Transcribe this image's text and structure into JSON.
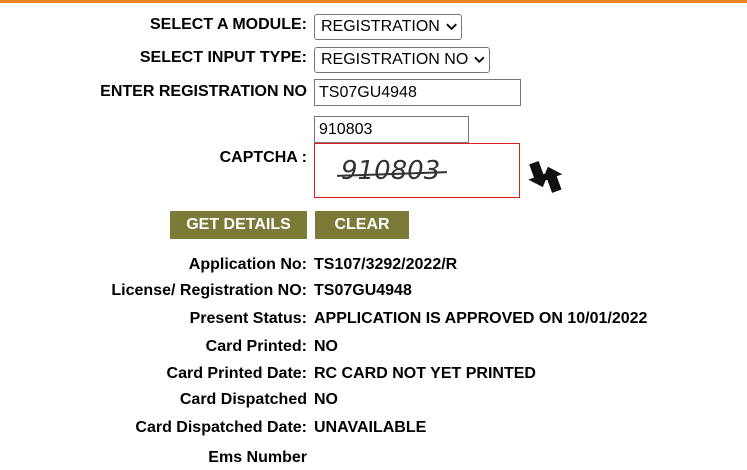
{
  "form": {
    "module_label": "SELECT A MODULE:",
    "module_value": "REGISTRATION",
    "input_type_label": "SELECT INPUT TYPE:",
    "input_type_value": "REGISTRATION NO",
    "reg_no_label": "ENTER REGISTRATION NO",
    "reg_no_value": "TS07GU4948",
    "captcha_input_value": "910803",
    "captcha_label": "CAPTCHA :",
    "captcha_image_text": "910803",
    "get_details_label": "GET DETAILS",
    "clear_label": "CLEAR"
  },
  "results": [
    {
      "label": "Application No:",
      "value": "TS107/3292/2022/R"
    },
    {
      "label": "License/ Registration NO:",
      "value": "TS07GU4948"
    },
    {
      "label": "Present Status:",
      "value": "APPLICATION IS APPROVED ON 10/01/2022"
    },
    {
      "label": "Card Printed:",
      "value": "NO"
    },
    {
      "label": "Card Printed Date:",
      "value": "RC CARD NOT YET PRINTED"
    },
    {
      "label": "Card Dispatched",
      "value": "NO"
    },
    {
      "label": "Card Dispatched Date:",
      "value": "UNAVAILABLE"
    },
    {
      "label": "Ems Number",
      "value": ""
    }
  ],
  "colors": {
    "top_bar": "#e8832a",
    "button_bg": "#7b7a37",
    "captcha_border": "#e02020"
  },
  "icons": {
    "refresh": "refresh-captcha-icon",
    "dropdown": "chevron-down-icon"
  }
}
